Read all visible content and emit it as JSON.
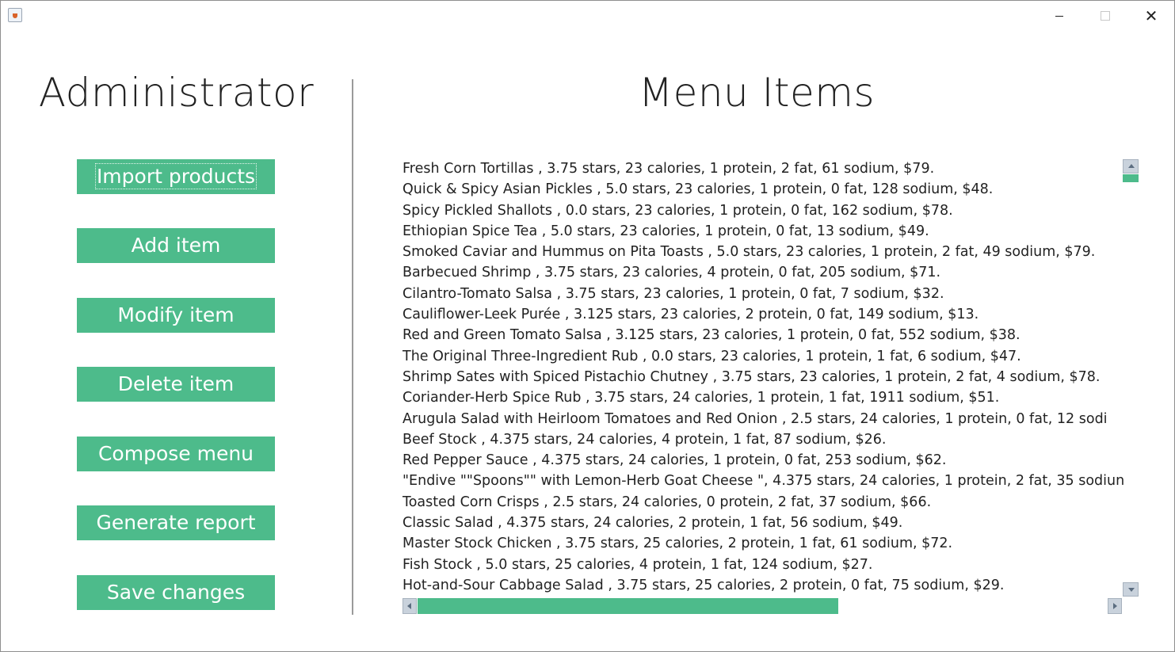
{
  "window": {
    "icon": "java-cup-icon",
    "controls": {
      "minimize_glyph": "—",
      "maximize_glyph": "□",
      "close_glyph": "✕"
    }
  },
  "left_panel": {
    "title": "Administrator",
    "buttons": [
      {
        "label": "Import products",
        "focused": true
      },
      {
        "label": "Add item"
      },
      {
        "label": "Modify item"
      },
      {
        "label": "Delete item"
      },
      {
        "label": "Compose menu"
      },
      {
        "label": "Generate report"
      },
      {
        "label": "Save changes"
      }
    ]
  },
  "right_panel": {
    "title": "Menu Items",
    "items": [
      "Fresh Corn Tortillas , 3.75 stars, 23 calories, 1 protein, 2 fat, 61 sodium, $79.",
      "Quick & Spicy Asian Pickles , 5.0 stars, 23 calories, 1 protein, 0 fat, 128 sodium, $48.",
      "Spicy Pickled Shallots , 0.0 stars, 23 calories, 1 protein, 0 fat, 162 sodium, $78.",
      "Ethiopian Spice Tea , 5.0 stars, 23 calories, 1 protein, 0 fat, 13 sodium, $49.",
      "Smoked Caviar and Hummus on Pita Toasts , 5.0 stars, 23 calories, 1 protein, 2 fat, 49 sodium, $79.",
      "Barbecued Shrimp , 3.75 stars, 23 calories, 4 protein, 0 fat, 205 sodium, $71.",
      "Cilantro-Tomato Salsa , 3.75 stars, 23 calories, 1 protein, 0 fat, 7 sodium, $32.",
      "Cauliflower-Leek Purée , 3.125 stars, 23 calories, 2 protein, 0 fat, 149 sodium, $13.",
      "Red and Green Tomato Salsa , 3.125 stars, 23 calories, 1 protein, 0 fat, 552 sodium, $38.",
      "The Original Three-Ingredient Rub , 0.0 stars, 23 calories, 1 protein, 1 fat, 6 sodium, $47.",
      "Shrimp Sates with Spiced Pistachio Chutney , 3.75 stars, 23 calories, 1 protein, 2 fat, 4 sodium, $78.",
      "Coriander-Herb Spice Rub , 3.75 stars, 24 calories, 1 protein, 1 fat, 1911 sodium, $51.",
      "Arugula Salad with Heirloom Tomatoes and Red Onion , 2.5 stars, 24 calories, 1 protein, 0 fat, 12 sodi",
      "Beef Stock , 4.375 stars, 24 calories, 4 protein, 1 fat, 87 sodium, $26.",
      "Red Pepper Sauce , 4.375 stars, 24 calories, 1 protein, 0 fat, 253 sodium, $62.",
      "\"Endive \"\"Spoons\"\" with Lemon-Herb Goat Cheese \", 4.375 stars, 24 calories, 1 protein, 2 fat, 35 sodiun",
      "Toasted Corn Crisps , 2.5 stars, 24 calories, 0 protein, 2 fat, 37 sodium, $66.",
      "Classic Salad , 4.375 stars, 24 calories, 2 protein, 1 fat, 56 sodium, $49.",
      "Master Stock Chicken , 3.75 stars, 25 calories, 2 protein, 1 fat, 61 sodium, $72.",
      "Fish Stock , 5.0 stars, 25 calories, 4 protein, 1 fat, 124 sodium, $27.",
      "Hot-and-Sour Cabbage Salad , 3.75 stars, 25 calories, 2 protein, 0 fat, 75 sodium, $29."
    ]
  },
  "colors": {
    "accent": "#4dbb8b",
    "text": "#222222",
    "background": "#ffffff"
  }
}
